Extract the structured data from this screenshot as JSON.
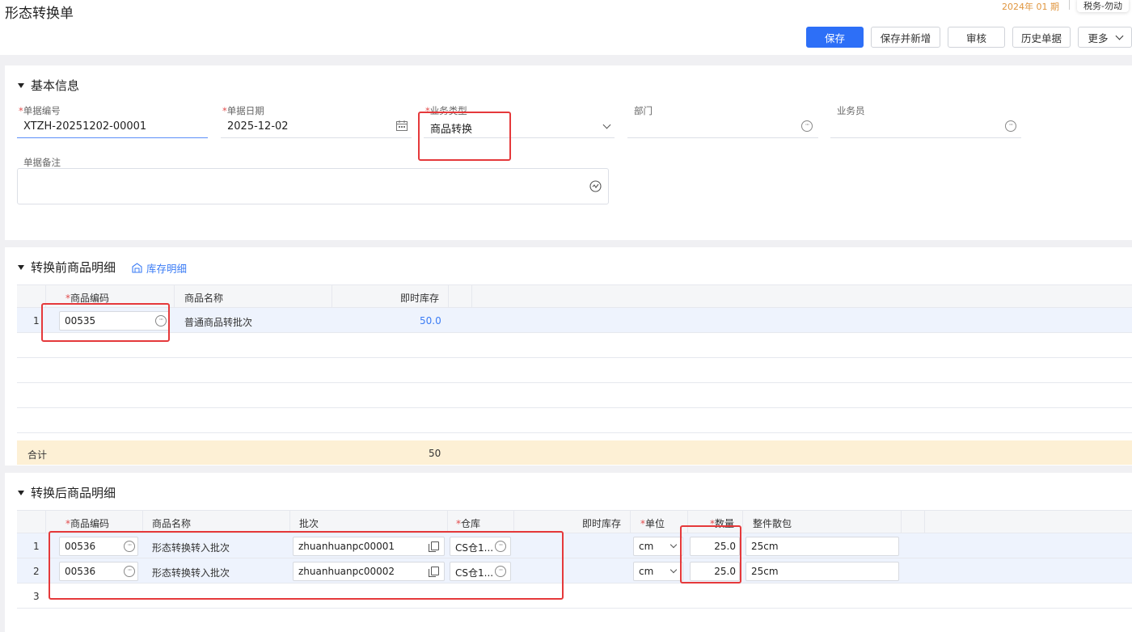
{
  "header": {
    "title": "形态转换单",
    "period": "2024年 01 期",
    "tax_tag": "税务-勿动"
  },
  "toolbar": {
    "save": "保存",
    "save_new": "保存并新增",
    "audit": "审核",
    "history": "历史单据",
    "more": "更多"
  },
  "basic": {
    "section_title": "基本信息",
    "doc_no_label": "单据编号",
    "doc_no_value": "XTZH-20251202-00001",
    "doc_date_label": "单据日期",
    "doc_date_value": "2025-12-02",
    "biz_type_label": "业务类型",
    "biz_type_value": "商品转换",
    "dept_label": "部门",
    "staff_label": "业务员",
    "remark_label": "单据备注"
  },
  "before": {
    "section_title": "转换前商品明细",
    "stock_link": "库存明细",
    "columns": {
      "code": "商品编码",
      "name": "商品名称",
      "stock": "即时库存"
    },
    "rows": [
      {
        "no": "1",
        "code": "00535",
        "name": "普通商品转批次",
        "stock": "50.0"
      }
    ],
    "total_label": "合计",
    "total_value": "50"
  },
  "after": {
    "section_title": "转换后商品明细",
    "columns": {
      "code": "商品编码",
      "name": "商品名称",
      "batch": "批次",
      "warehouse": "仓库",
      "stock": "即时库存",
      "unit": "单位",
      "qty": "数量",
      "pack": "整件散包"
    },
    "rows": [
      {
        "no": "1",
        "code": "00536",
        "name": "形态转换转入批次",
        "batch": "zhuanhuanpc00001",
        "warehouse": "CS仓1...",
        "unit": "cm",
        "qty": "25.0",
        "pack": "25cm"
      },
      {
        "no": "2",
        "code": "00536",
        "name": "形态转换转入批次",
        "batch": "zhuanhuanpc00002",
        "warehouse": "CS仓1...",
        "unit": "cm",
        "qty": "25.0",
        "pack": "25cm"
      },
      {
        "no": "3"
      }
    ]
  },
  "colors": {
    "primary": "#2d6ff7",
    "required": "#e34d4d",
    "highlight": "#e5393b",
    "period": "#e0963f",
    "link": "#3b7cf5"
  }
}
